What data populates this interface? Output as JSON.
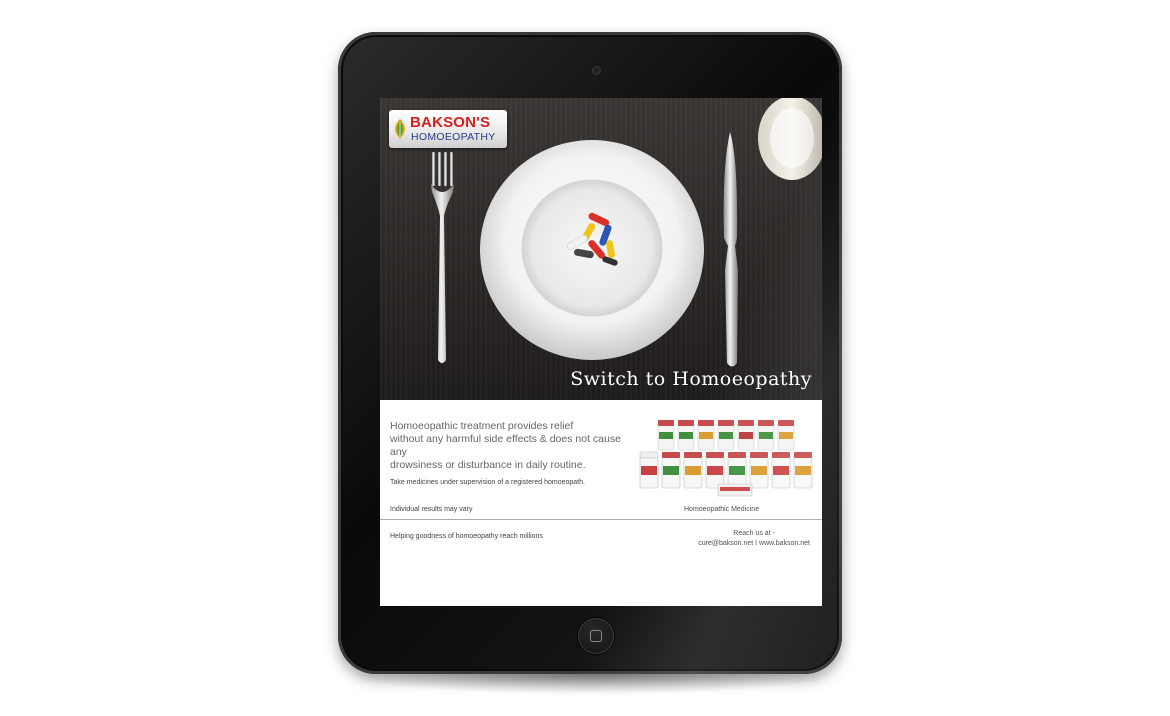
{
  "ad": {
    "brand_name": "BAKSON'S",
    "brand_sub": "HOMOEOPATHY",
    "tagline": "Switch to Homoeopathy",
    "body_line1": "Homoeopathic treatment provides relief",
    "body_line2": "without any harmful side effects & does not cause any",
    "body_line3": "drowsiness or disturbance in daily routine.",
    "supervision_note": "Take medicines under supervision of a registered homoeopath.",
    "disclaimer": "Individual results may vary",
    "product_caption": "Homoeopathic Medicine",
    "footer_slogan": "Helping goodness of homoeopathy reach millions",
    "reach_label": "Reach us at -",
    "reach_contact": "cure@bakson.net I www.bakson.net"
  },
  "colors": {
    "brand_red": "#d3201f",
    "brand_blue": "#2c3a8a",
    "hero_dark": "#2a2725"
  },
  "icons": [
    "leaf-logo-icon",
    "camera-icon",
    "home-button-icon"
  ]
}
